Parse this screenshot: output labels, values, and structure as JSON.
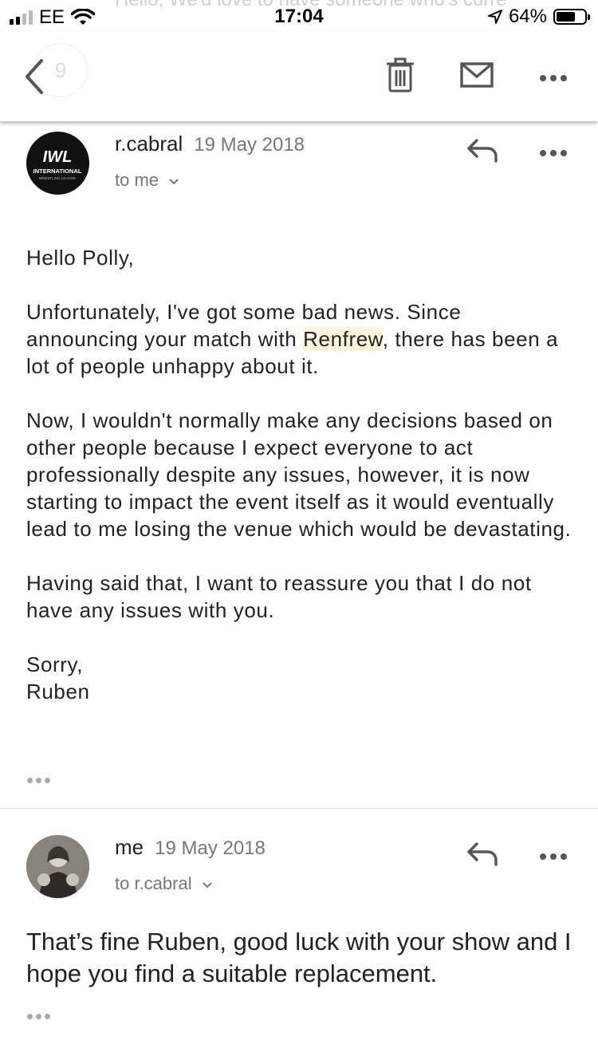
{
  "status_bar": {
    "carrier": "EE",
    "time": "17:04",
    "battery_percent": "64%",
    "battery_level": 0.64
  },
  "background_preview": "Hello, We'd love to have someone who's curre",
  "toolbar": {
    "back_count": "9",
    "icons": [
      "back-icon",
      "trash-icon",
      "mail-icon",
      "more-icon"
    ]
  },
  "messages": [
    {
      "sender": "r.cabral",
      "date": "19 May 2018",
      "to": "to me",
      "avatar_text": "IWL",
      "avatar_subtext": "INTERNATIONAL",
      "avatar_subtext2": "WRESTLING LEAGUE",
      "body": {
        "greeting": "Hello Polly,",
        "p1_before": "Unfortunately, I've got some bad news. Since announcing your match with ",
        "p1_highlight": "Renfrew",
        "p1_after": ", there has been a lot of people unhappy about it.",
        "p2": "Now, I wouldn't normally make any decisions based on other people because I expect everyone to act professionally despite any issues, however, it is now starting to impact the event itself as it would eventually lead to me losing the venue which would be devastating.",
        "p3": "Having said that, I want to reassure you that I do not have any issues with you.",
        "signoff": "Sorry,",
        "signature": "Ruben"
      }
    },
    {
      "sender": "me",
      "date": "19 May 2018",
      "to": "to r.cabral",
      "body": "That’s fine Ruben, good luck with your show and I hope you find a suitable replacement."
    }
  ],
  "colors": {
    "highlight": "#fdf4dd",
    "icon": "#555555",
    "meta": "#777777"
  }
}
